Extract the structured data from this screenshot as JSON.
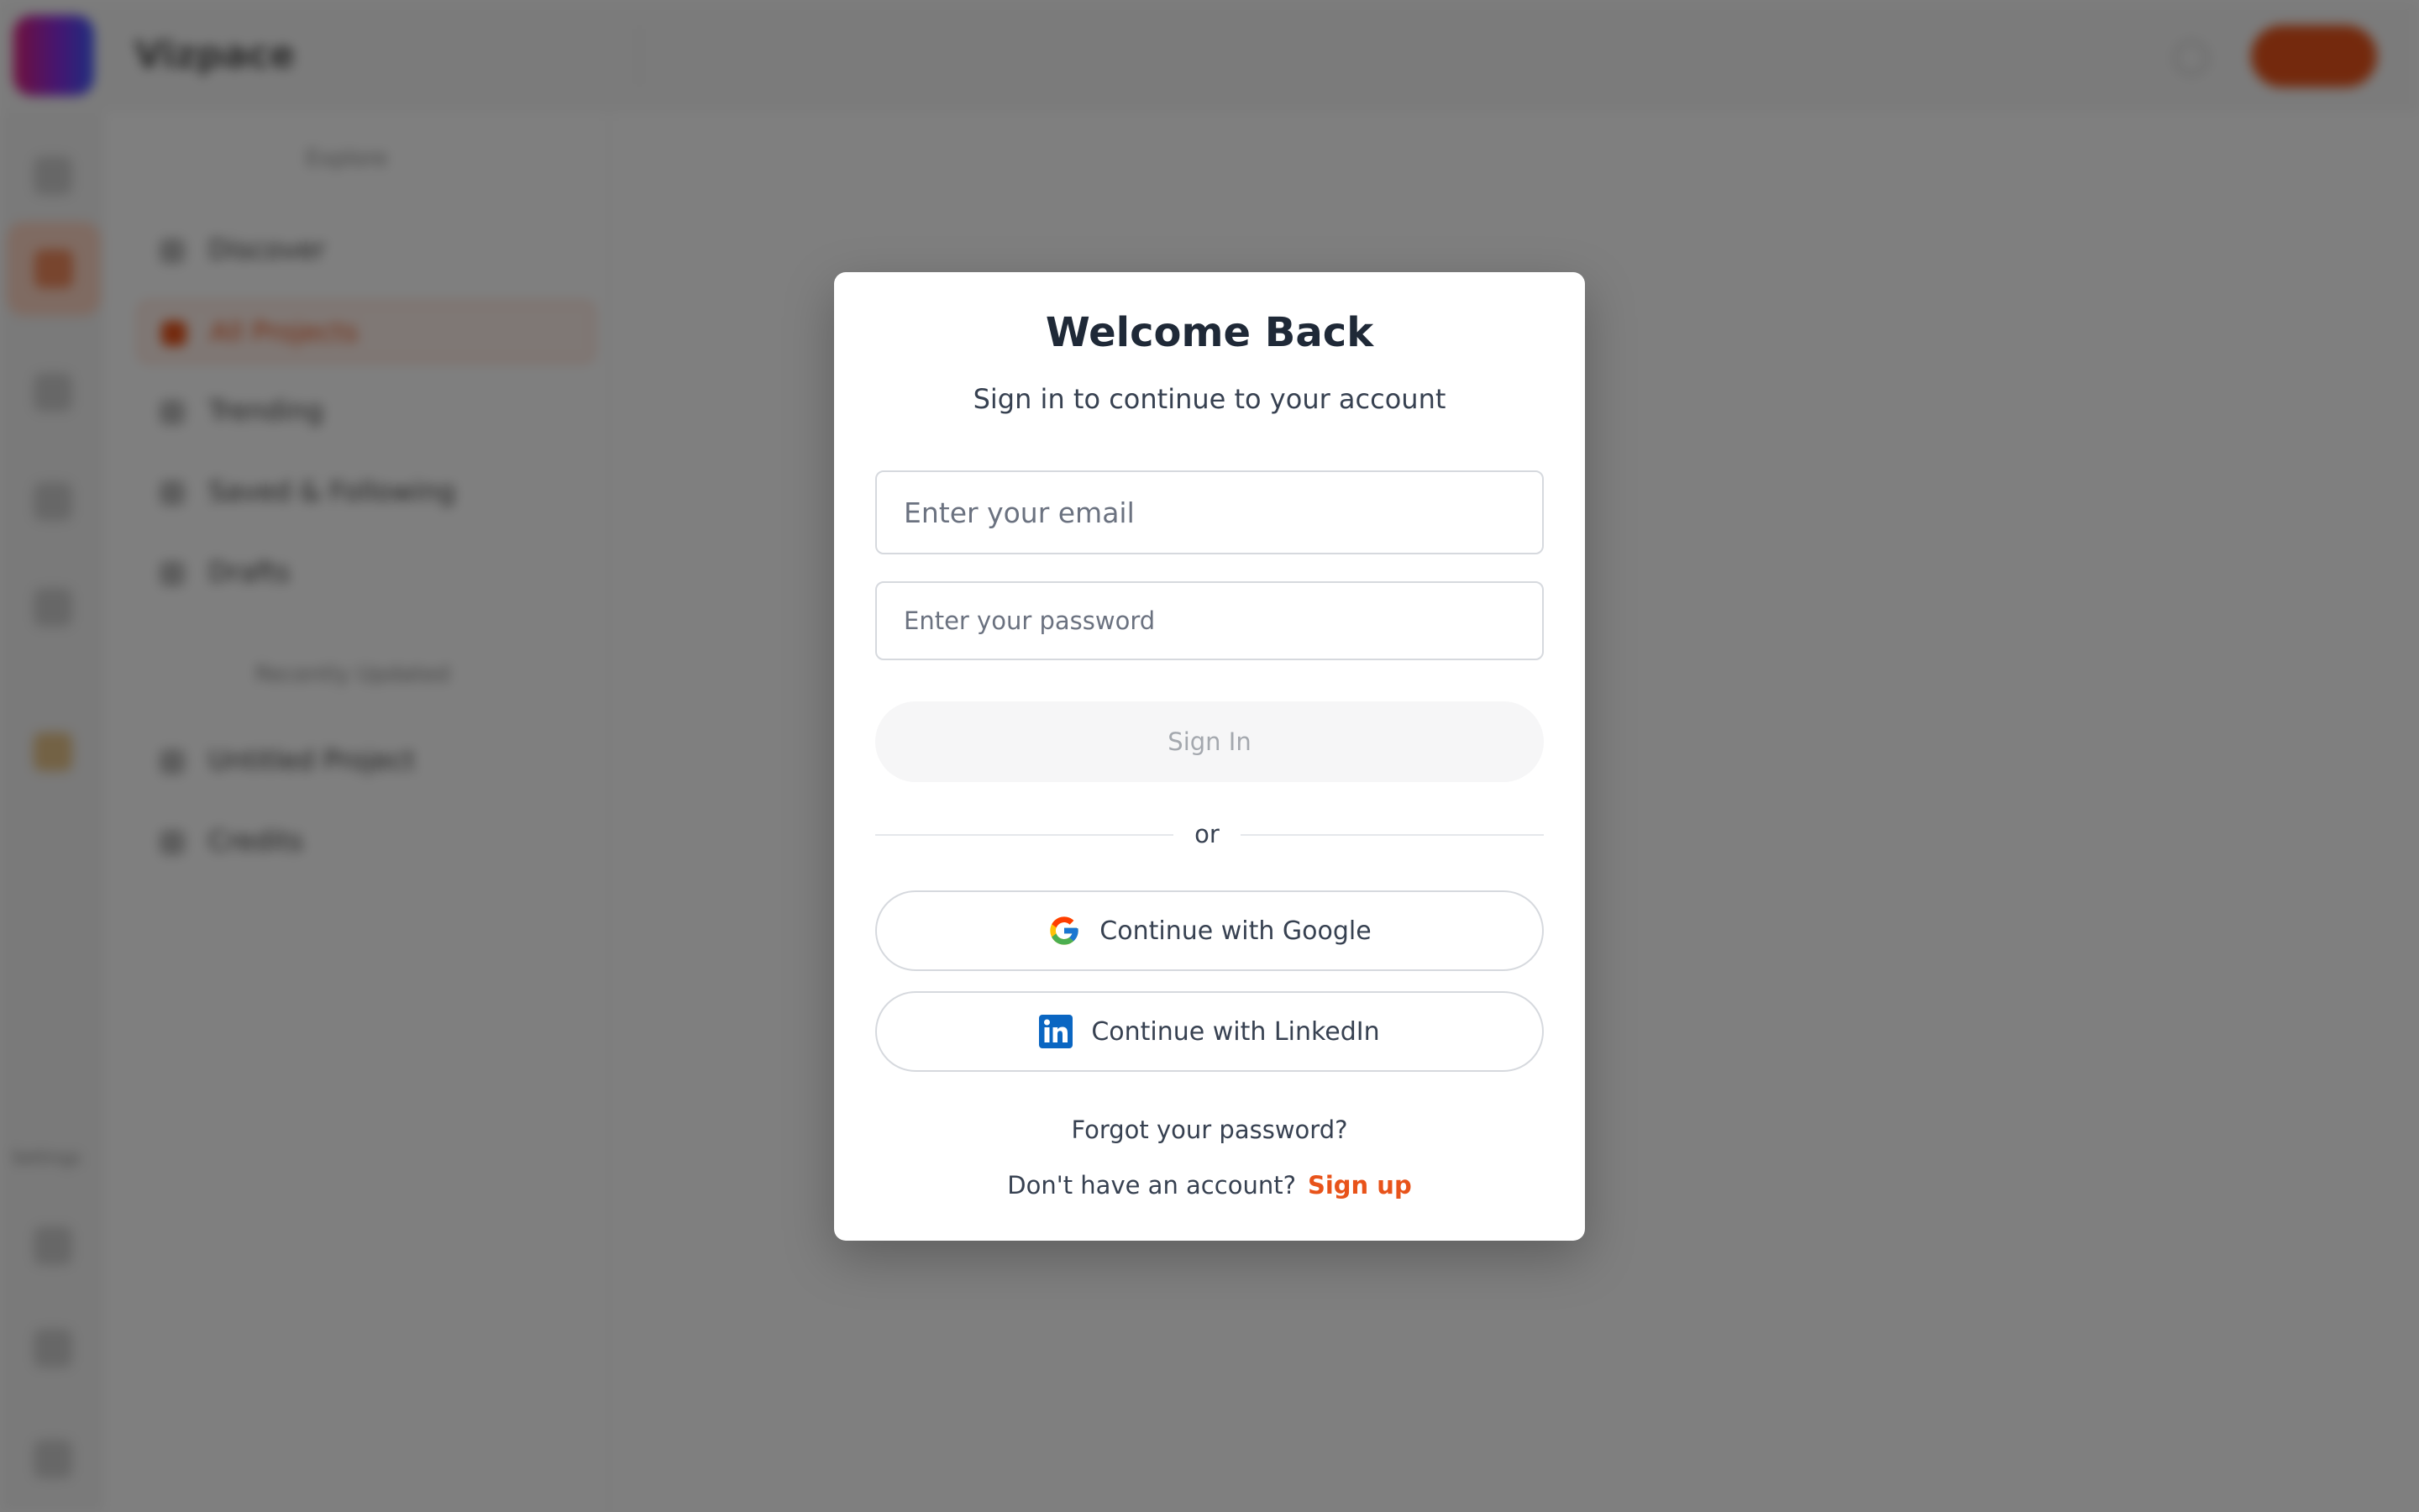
{
  "background": {
    "brand": "Vizpace",
    "sidebar": {
      "section_1": "Explore",
      "items_1": [
        "Discover",
        "All Projects",
        "Trending",
        "Saved & Following",
        "Drafts"
      ],
      "section_2": "Recently Updated",
      "items_2": [
        "Untitled Project",
        "Credits"
      ],
      "active_item": "All Projects"
    },
    "rail_bottom_label": "Settings"
  },
  "modal": {
    "title": "Welcome Back",
    "subtitle": "Sign in to continue to your account",
    "email_placeholder": "Enter your email",
    "password_placeholder": "Enter your password",
    "signin_label": "Sign In",
    "divider": "or",
    "google_label": "Continue with Google",
    "linkedin_label": "Continue with LinkedIn",
    "forgot_label": "Forgot your password?",
    "no_account_text": "Don't have an account?",
    "signup_label": "Sign up"
  },
  "colors": {
    "accent": "#e8531a",
    "overlay": "rgba(0,0,0,0.5)",
    "linkedin": "#0a66c2"
  },
  "icons": [
    "google-icon",
    "linkedin-icon"
  ]
}
